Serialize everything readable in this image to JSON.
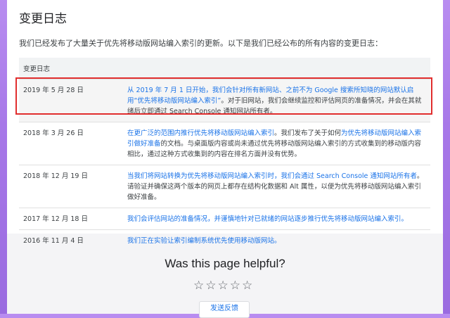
{
  "page": {
    "title": "变更日志"
  },
  "intro": "我们已经发布了大量关于优先将移动版网站编入索引的更新。以下是我们已经公布的所有内容的变更日志：",
  "table": {
    "header": "变更日志",
    "rows": [
      {
        "date": "2019 年 5 月 28 日",
        "parts": [
          {
            "text": "从 2019 年 7 月 1 日开始，我们会针对所有新网站、之前不为 Google 搜索所知晓的网站默认启用“优先将移动版网站编入索引”",
            "link": true
          },
          {
            "text": "。对于旧网站，我们会继续监控和评估网页的准备情况，并会在其就绪后立即通过 Search Console 通知网站所有者。",
            "link": false
          }
        ]
      },
      {
        "date": "2018 年 3 月 26 日",
        "parts": [
          {
            "text": "在更广泛的范围内推行优先将移动版网站编入索引",
            "link": true
          },
          {
            "text": "。我们发布了关于如何",
            "link": false
          },
          {
            "text": "为优先将移动版网站编入索引做好准备",
            "link": true
          },
          {
            "text": "的文档。与桌面版内容或尚未通过优先将移动版网站编入索引的方式收集到的移动版内容相比，通过这种方式收集到的内容在排名方面并没有优势。",
            "link": false
          }
        ]
      },
      {
        "date": "2018 年 12 月 19 日",
        "parts": [
          {
            "text": "当我们将网站转换为优先将移动版网站编入索引时，我们会通过 Search Console 通知网站所有者",
            "link": true
          },
          {
            "text": "。请验证并确保这两个版本的网页上都存在结构化数据和 Alt 属性，以便为优先将移动版网站编入索引做好准备。",
            "link": false
          }
        ]
      },
      {
        "date": "2017 年 12 月 18 日",
        "parts": [
          {
            "text": "我们会评估网站的准备情况，并谨慎地针对已就绪的网站逐步推行优先将移动版网站编入索引。",
            "link": true
          }
        ]
      },
      {
        "date": "2016 年 11 月 4 日",
        "parts": [
          {
            "text": "我们正在实验让索引编制系统优先使用移动版网站。",
            "link": true
          }
        ]
      }
    ]
  },
  "feedback": {
    "question": "Was this page helpful?",
    "stars": [
      "☆",
      "☆",
      "☆",
      "☆",
      "☆"
    ],
    "button_label": "发送反馈"
  }
}
